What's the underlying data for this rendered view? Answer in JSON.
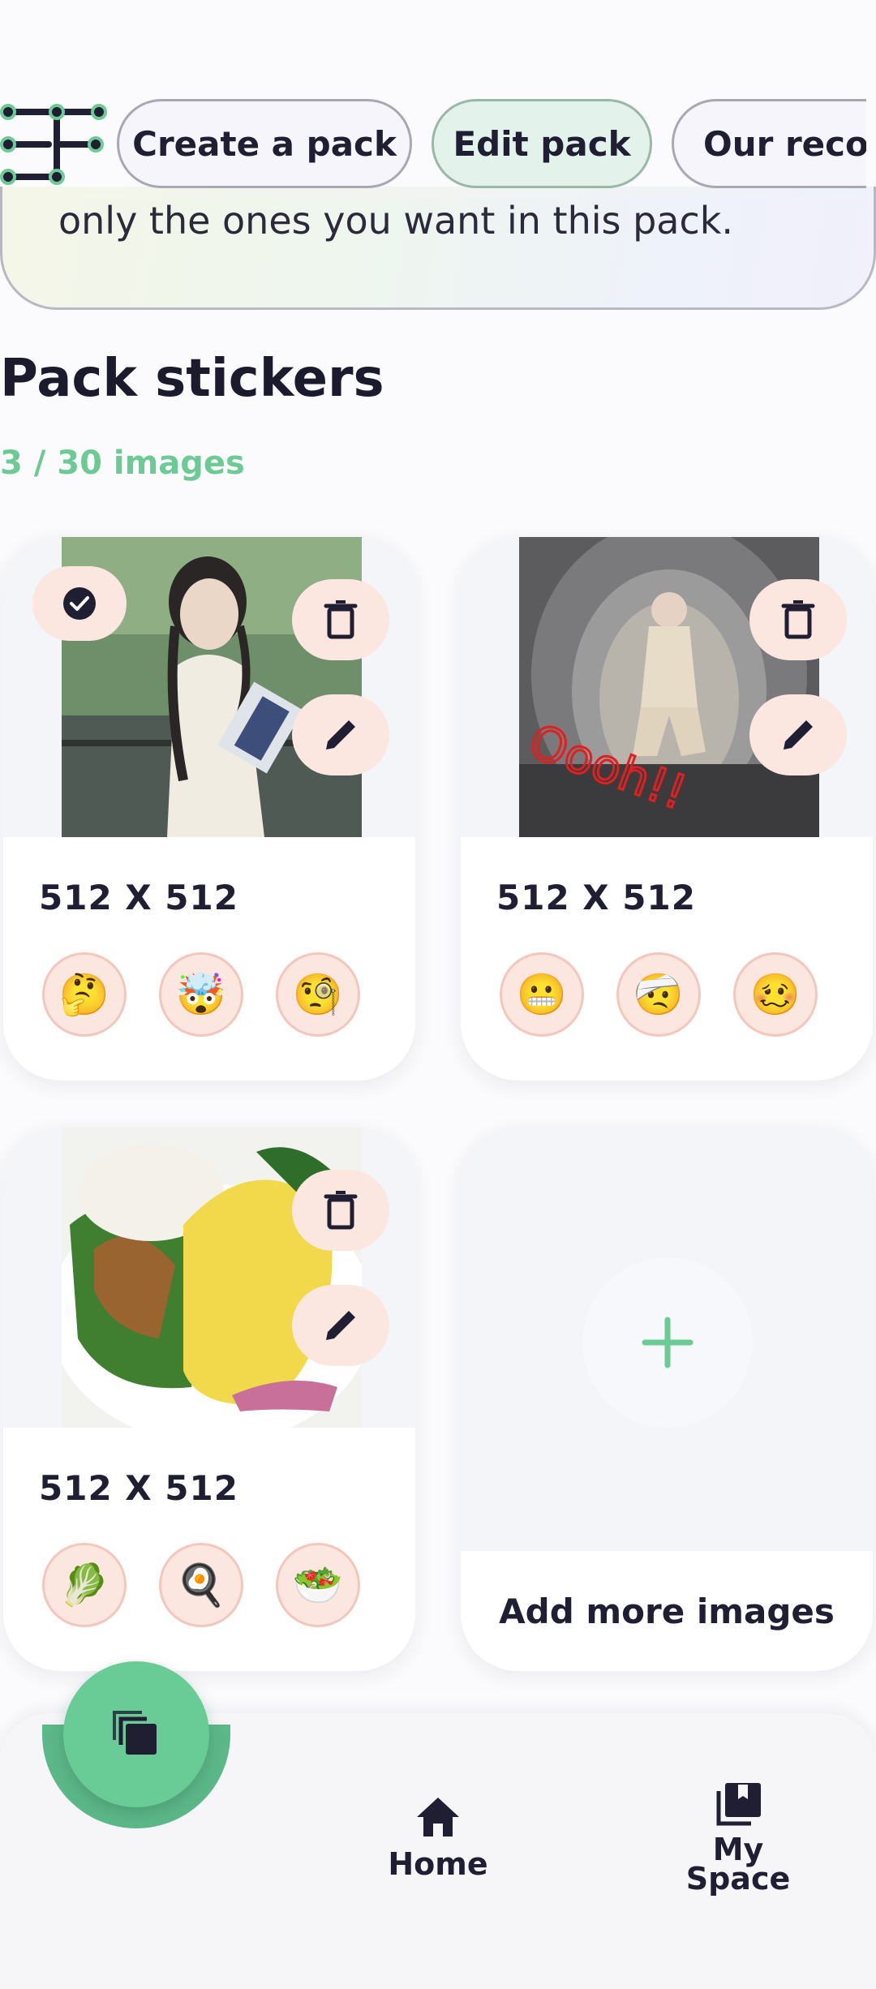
{
  "topbar": {
    "logo_icon": "app-logo-icon",
    "chips": [
      {
        "label": "Create a pack",
        "active": false
      },
      {
        "label": "Edit pack",
        "active": true
      },
      {
        "label": "Our recon",
        "active": false
      }
    ]
  },
  "info": {
    "text": "only the ones you want in this pack."
  },
  "section": {
    "title": "Pack stickers",
    "count": "3 / 30 images"
  },
  "stickers": [
    {
      "size": "512 X 512",
      "selected": true,
      "emojis": [
        "🤔",
        "🤯",
        "🧐"
      ],
      "image": "woman-reading-book"
    },
    {
      "size": "512 X 512",
      "selected": false,
      "emojis": [
        "😬",
        "🤕",
        "🥴"
      ],
      "image": "person-in-dragon-mouth",
      "caption": "Oooh!!"
    },
    {
      "size": "512 X 512",
      "selected": false,
      "emojis": [
        "🥬",
        "🍳",
        "🥗"
      ],
      "image": "omelette-salad"
    }
  ],
  "add_card": {
    "label": "Add more images"
  },
  "nav": {
    "home_label": "Home",
    "myspace_label": "My\nSpace"
  },
  "colors": {
    "accent": "#6ccb95",
    "chip_bg": "#fbe6e0",
    "text": "#1f1e33"
  }
}
